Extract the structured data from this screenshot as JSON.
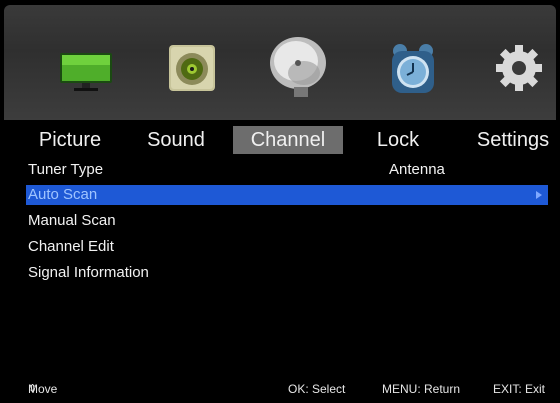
{
  "icons": [
    "picture-icon",
    "sound-icon",
    "channel-icon",
    "lock-icon",
    "settings-icon"
  ],
  "tabs": [
    {
      "label": "Picture"
    },
    {
      "label": "Sound"
    },
    {
      "label": "Channel"
    },
    {
      "label": "Lock"
    },
    {
      "label": "Settings"
    }
  ],
  "active_tab": "Channel",
  "menu": {
    "tuner_type": {
      "label": "Tuner Type",
      "value": "Antenna"
    },
    "items": [
      {
        "label": "Auto Scan"
      },
      {
        "label": "Manual Scan"
      },
      {
        "label": "Channel Edit"
      },
      {
        "label": "Signal Information"
      }
    ]
  },
  "footer": {
    "updown_glyph": "⇕",
    "move": "Move",
    "select": "OK: Select",
    "return": "MENU: Return",
    "exit": "EXIT: Exit"
  },
  "colors": {
    "highlight": "#1e59d6",
    "active_tab": "#6d6d6d",
    "icon_bar": "#353535"
  }
}
